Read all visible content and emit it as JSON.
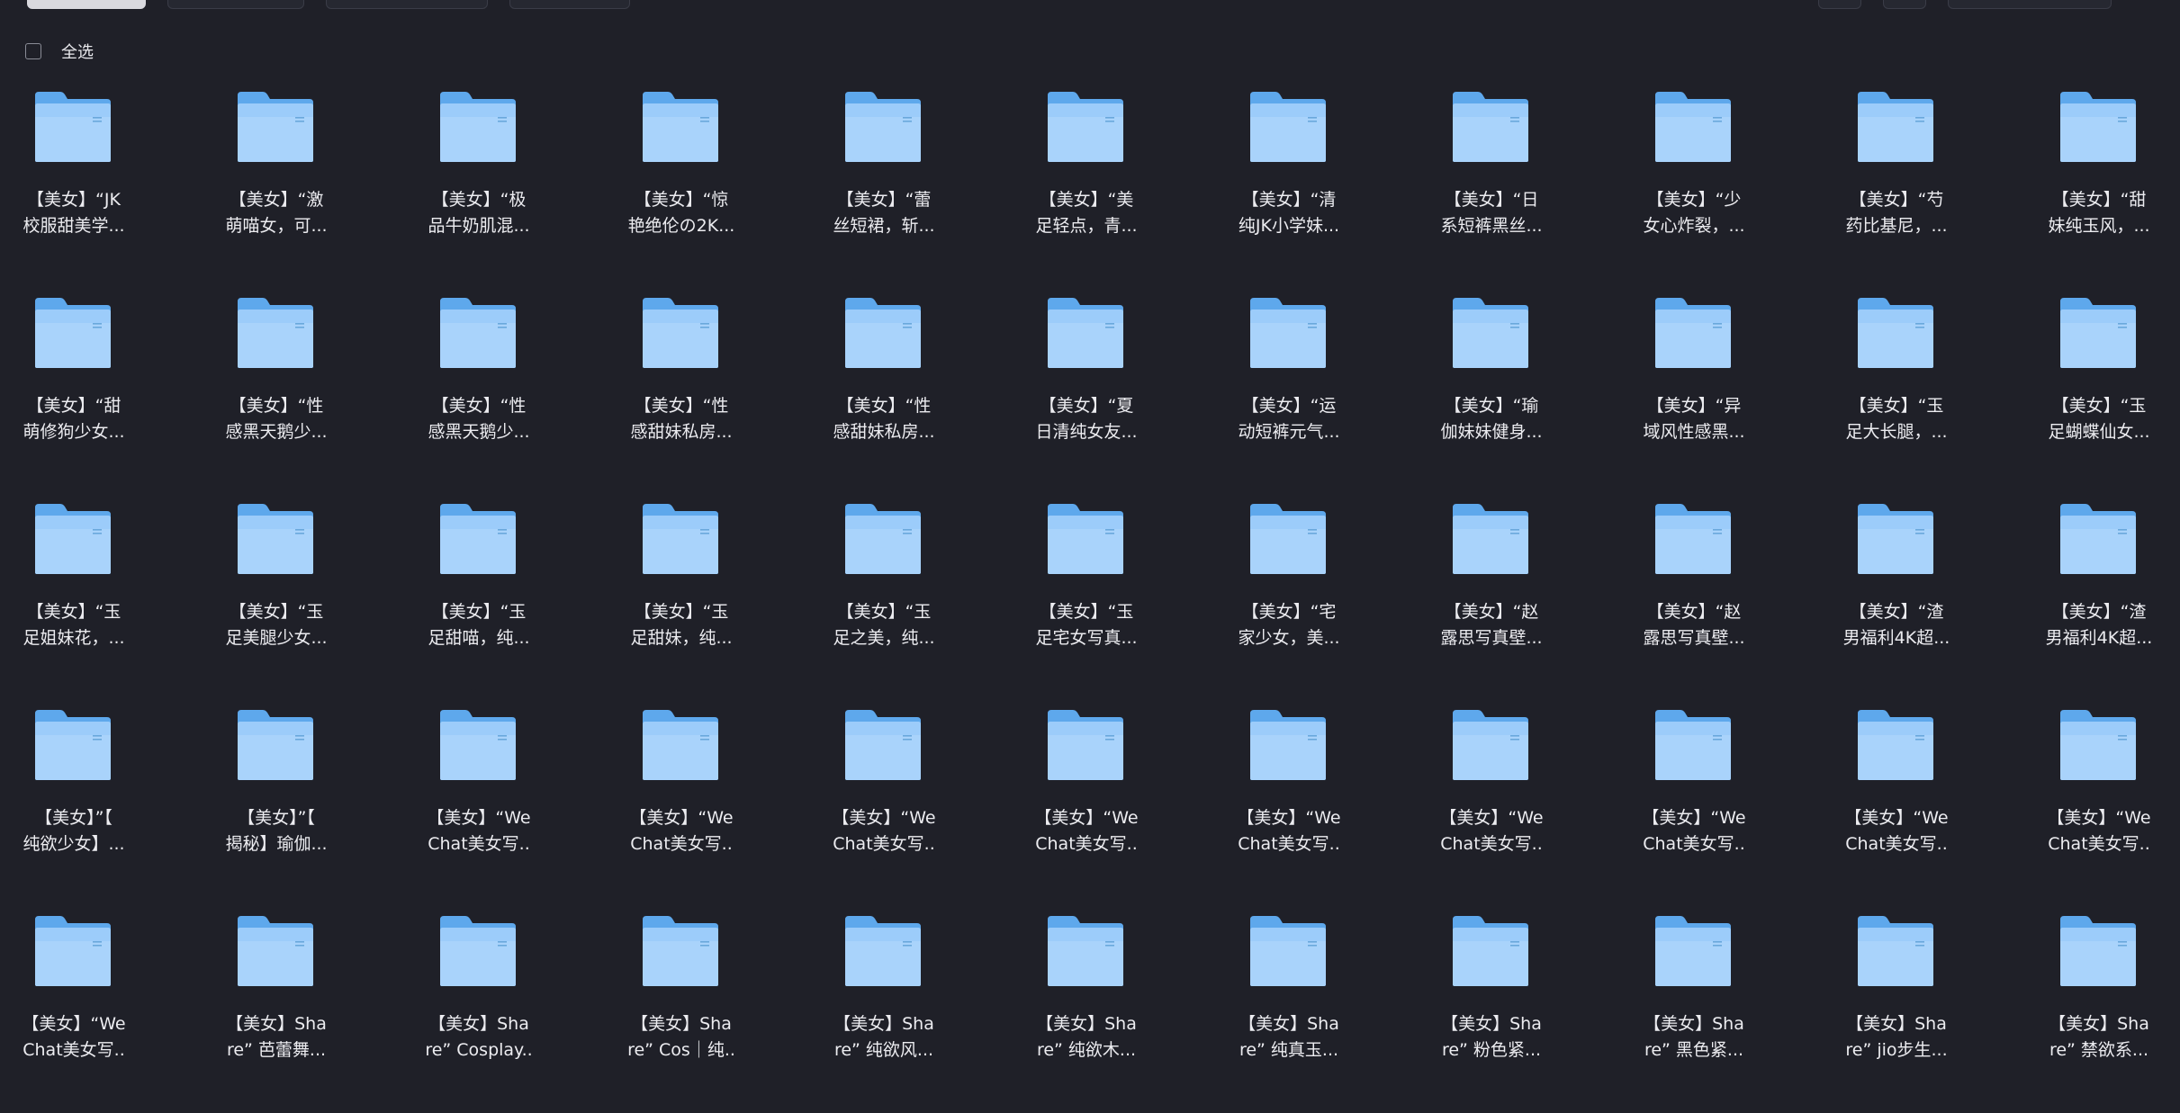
{
  "toolbar": {
    "select_all_label": "全选"
  },
  "folders": [
    [
      {
        "line1": "【美女】“JK",
        "line2": "校服甜美学..."
      },
      {
        "line1": "【美女】“激",
        "line2": "萌喵女，可..."
      },
      {
        "line1": "【美女】“极",
        "line2": "品牛奶肌混..."
      },
      {
        "line1": "【美女】“惊",
        "line2": "艳绝伦の2K..."
      },
      {
        "line1": "【美女】“蕾",
        "line2": "丝短裙，斩..."
      },
      {
        "line1": "【美女】“美",
        "line2": "足轻点，青..."
      },
      {
        "line1": "【美女】“清",
        "line2": "纯JK小学妹..."
      },
      {
        "line1": "【美女】“日",
        "line2": "系短裤黑丝..."
      },
      {
        "line1": "【美女】“少",
        "line2": "女心炸裂，..."
      },
      {
        "line1": "【美女】“芍",
        "line2": "药比基尼，..."
      },
      {
        "line1": "【美女】“甜",
        "line2": "妹纯玉风，..."
      }
    ],
    [
      {
        "line1": "【美女】“甜",
        "line2": "萌修狗少女..."
      },
      {
        "line1": "【美女】“性",
        "line2": "感黑天鹅少..."
      },
      {
        "line1": "【美女】“性",
        "line2": "感黑天鹅少..."
      },
      {
        "line1": "【美女】“性",
        "line2": "感甜妹私房..."
      },
      {
        "line1": "【美女】“性",
        "line2": "感甜妹私房..."
      },
      {
        "line1": "【美女】“夏",
        "line2": "日清纯女友..."
      },
      {
        "line1": "【美女】“运",
        "line2": "动短裤元气..."
      },
      {
        "line1": "【美女】“瑜",
        "line2": "伽妹妹健身..."
      },
      {
        "line1": "【美女】“异",
        "line2": "域风性感黑..."
      },
      {
        "line1": "【美女】“玉",
        "line2": "足大长腿，..."
      },
      {
        "line1": "【美女】“玉",
        "line2": "足蝴蝶仙女..."
      }
    ],
    [
      {
        "line1": "【美女】“玉",
        "line2": "足姐妹花，..."
      },
      {
        "line1": "【美女】“玉",
        "line2": "足美腿少女..."
      },
      {
        "line1": "【美女】“玉",
        "line2": "足甜喵，纯..."
      },
      {
        "line1": "【美女】“玉",
        "line2": "足甜妹，纯..."
      },
      {
        "line1": "【美女】“玉",
        "line2": "足之美，纯..."
      },
      {
        "line1": "【美女】“玉",
        "line2": "足宅女写真..."
      },
      {
        "line1": "【美女】“宅",
        "line2": "家少女，美..."
      },
      {
        "line1": "【美女】“赵",
        "line2": "露思写真壁..."
      },
      {
        "line1": "【美女】“赵",
        "line2": "露思写真壁..."
      },
      {
        "line1": "【美女】“渣",
        "line2": "男福利4K超..."
      },
      {
        "line1": "【美女】“渣",
        "line2": "男福利4K超..."
      }
    ],
    [
      {
        "line1": "【美女】”【",
        "line2": "纯欲少女】..."
      },
      {
        "line1": "【美女】”【",
        "line2": "揭秘】瑜伽..."
      },
      {
        "line1": "【美女】“We",
        "line2": "Chat美女写.."
      },
      {
        "line1": "【美女】“We",
        "line2": "Chat美女写.."
      },
      {
        "line1": "【美女】“We",
        "line2": "Chat美女写.."
      },
      {
        "line1": "【美女】“We",
        "line2": "Chat美女写.."
      },
      {
        "line1": "【美女】“We",
        "line2": "Chat美女写.."
      },
      {
        "line1": "【美女】“We",
        "line2": "Chat美女写.."
      },
      {
        "line1": "【美女】“We",
        "line2": "Chat美女写.."
      },
      {
        "line1": "【美女】“We",
        "line2": "Chat美女写.."
      },
      {
        "line1": "【美女】“We",
        "line2": "Chat美女写.."
      }
    ],
    [
      {
        "line1": "【美女】“We",
        "line2": "Chat美女写.."
      },
      {
        "line1": "【美女】Sha",
        "line2": "re” 芭蕾舞..."
      },
      {
        "line1": "【美女】Sha",
        "line2": "re” Cosplay.."
      },
      {
        "line1": "【美女】Sha",
        "line2": "re” Cos｜纯.."
      },
      {
        "line1": "【美女】Sha",
        "line2": "re” 纯欲风..."
      },
      {
        "line1": "【美女】Sha",
        "line2": "re” 纯欲木..."
      },
      {
        "line1": "【美女】Sha",
        "line2": "re” 纯真玉..."
      },
      {
        "line1": "【美女】Sha",
        "line2": "re” 粉色紧..."
      },
      {
        "line1": "【美女】Sha",
        "line2": "re” 黑色紧..."
      },
      {
        "line1": "【美女】Sha",
        "line2": "re” jio步生..."
      },
      {
        "line1": "【美女】Sha",
        "line2": "re” 禁欲系..."
      }
    ]
  ],
  "colors": {
    "background": "#1f2028",
    "folder_back": "#5ea8ec",
    "folder_front": "#a9d3fb",
    "text": "#ececf0"
  }
}
